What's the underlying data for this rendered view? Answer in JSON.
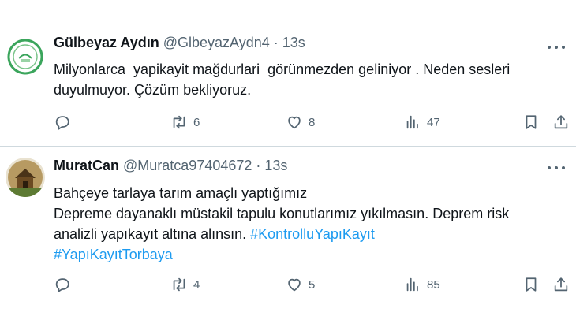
{
  "tweets": [
    {
      "display_name": "Gülbeyaz Aydın",
      "handle": "@GlbeyazAydn4",
      "separator": "·",
      "time": "13s",
      "text_lines": [
        "Milyonlarca  yapikayit mağdurlari  görünmezden geliniyor . Neden sesleri",
        "duyulmuyor. Çözüm bekliyoruz."
      ],
      "stats": {
        "replies": "",
        "reposts": "6",
        "likes": "8",
        "views": "47"
      }
    },
    {
      "display_name": "MuratCan",
      "handle": "@Muratca97404672",
      "separator": "·",
      "time": "13s",
      "text_lines": [
        "Bahçeye tarlaya tarım amaçlı yaptığımız",
        "Depreme dayanaklı müstakil tapulu konutlarımız yıkılmasın. Deprem risk",
        "analizli yapıkayıt altına alınsın. "
      ],
      "hashtags": [
        "#KontrolluYapıKayıt",
        "#YapıKayıtTorbaya"
      ],
      "stats": {
        "replies": "",
        "reposts": "4",
        "likes": "5",
        "views": "85"
      }
    }
  ],
  "colors": {
    "accent": "#1d9bf0",
    "secondary_text": "#536471",
    "divider": "#cfd9de"
  },
  "icons": [
    "more-icon",
    "reply-icon",
    "repost-icon",
    "like-icon",
    "views-icon",
    "bookmark-icon",
    "share-icon"
  ]
}
